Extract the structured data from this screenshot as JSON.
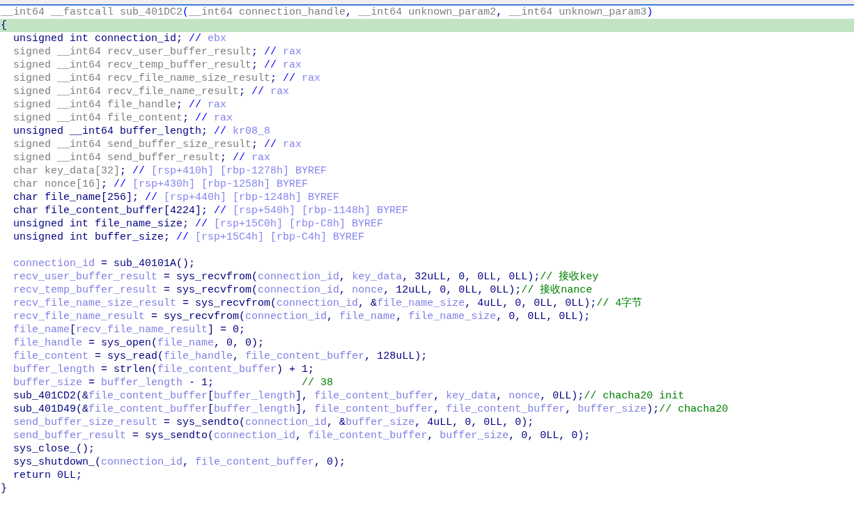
{
  "lines": [
    {
      "kind": "edge",
      "selected": false,
      "tokens": [
        {
          "kind": "g",
          "text": "__int64 __fastcall sub_401DC2"
        },
        {
          "kind": "b",
          "text": "("
        },
        {
          "kind": "g",
          "text": "__int64 connection_handle"
        },
        {
          "kind": "p",
          "text": ", "
        },
        {
          "kind": "g",
          "text": "__int64 unknown_param2"
        },
        {
          "kind": "p",
          "text": ", "
        },
        {
          "kind": "g",
          "text": "__int64 unknown_param3"
        },
        {
          "kind": "b",
          "text": ")"
        }
      ]
    },
    {
      "kind": "edge",
      "selected": true,
      "tokens": [
        {
          "kind": "p",
          "text": "{"
        }
      ]
    },
    {
      "kind": "stmt",
      "selected": false,
      "tokens": [
        {
          "kind": "p",
          "text": "unsigned int connection_id; "
        },
        {
          "kind": "b",
          "text": "// "
        },
        {
          "kind": "r",
          "text": "ebx"
        }
      ]
    },
    {
      "kind": "stmt",
      "selected": false,
      "tokens": [
        {
          "kind": "g",
          "text": "signed __int64 recv_user_buffer_result"
        },
        {
          "kind": "p",
          "text": "; "
        },
        {
          "kind": "b",
          "text": "// "
        },
        {
          "kind": "r",
          "text": "rax"
        }
      ]
    },
    {
      "kind": "stmt",
      "selected": false,
      "tokens": [
        {
          "kind": "g",
          "text": "signed __int64 recv_temp_buffer_result"
        },
        {
          "kind": "p",
          "text": "; "
        },
        {
          "kind": "b",
          "text": "// "
        },
        {
          "kind": "r",
          "text": "rax"
        }
      ]
    },
    {
      "kind": "stmt",
      "selected": false,
      "tokens": [
        {
          "kind": "g",
          "text": "signed __int64 recv_file_name_size_result"
        },
        {
          "kind": "p",
          "text": "; "
        },
        {
          "kind": "b",
          "text": "// "
        },
        {
          "kind": "r",
          "text": "rax"
        }
      ]
    },
    {
      "kind": "stmt",
      "selected": false,
      "tokens": [
        {
          "kind": "g",
          "text": "signed __int64 recv_file_name_result"
        },
        {
          "kind": "p",
          "text": "; "
        },
        {
          "kind": "b",
          "text": "// "
        },
        {
          "kind": "r",
          "text": "rax"
        }
      ]
    },
    {
      "kind": "stmt",
      "selected": false,
      "tokens": [
        {
          "kind": "g",
          "text": "signed __int64 file_handle"
        },
        {
          "kind": "p",
          "text": "; "
        },
        {
          "kind": "b",
          "text": "// "
        },
        {
          "kind": "r",
          "text": "rax"
        }
      ]
    },
    {
      "kind": "stmt",
      "selected": false,
      "tokens": [
        {
          "kind": "g",
          "text": "signed __int64 file_content"
        },
        {
          "kind": "p",
          "text": "; "
        },
        {
          "kind": "b",
          "text": "// "
        },
        {
          "kind": "r",
          "text": "rax"
        }
      ]
    },
    {
      "kind": "stmt",
      "selected": false,
      "tokens": [
        {
          "kind": "p",
          "text": "unsigned __int64 buffer_length; "
        },
        {
          "kind": "b",
          "text": "// "
        },
        {
          "kind": "r",
          "text": "kr08_8"
        }
      ]
    },
    {
      "kind": "stmt",
      "selected": false,
      "tokens": [
        {
          "kind": "g",
          "text": "signed __int64 send_buffer_size_result"
        },
        {
          "kind": "p",
          "text": "; "
        },
        {
          "kind": "b",
          "text": "// "
        },
        {
          "kind": "r",
          "text": "rax"
        }
      ]
    },
    {
      "kind": "stmt",
      "selected": false,
      "tokens": [
        {
          "kind": "g",
          "text": "signed __int64 send_buffer_result"
        },
        {
          "kind": "p",
          "text": "; "
        },
        {
          "kind": "b",
          "text": "// "
        },
        {
          "kind": "r",
          "text": "rax"
        }
      ]
    },
    {
      "kind": "stmt",
      "selected": false,
      "tokens": [
        {
          "kind": "g",
          "text": "char key_data[32]"
        },
        {
          "kind": "p",
          "text": "; "
        },
        {
          "kind": "b",
          "text": "// "
        },
        {
          "kind": "r",
          "text": "[rsp+410h] [rbp-1278h] BYREF"
        }
      ]
    },
    {
      "kind": "stmt",
      "selected": false,
      "tokens": [
        {
          "kind": "g",
          "text": "char nonce[16]"
        },
        {
          "kind": "p",
          "text": "; "
        },
        {
          "kind": "b",
          "text": "// "
        },
        {
          "kind": "r",
          "text": "[rsp+430h] [rbp-1258h] BYREF"
        }
      ]
    },
    {
      "kind": "stmt",
      "selected": false,
      "tokens": [
        {
          "kind": "p",
          "text": "char file_name[256]; "
        },
        {
          "kind": "b",
          "text": "// "
        },
        {
          "kind": "r",
          "text": "[rsp+440h] [rbp-1248h] BYREF"
        }
      ]
    },
    {
      "kind": "stmt",
      "selected": false,
      "tokens": [
        {
          "kind": "p",
          "text": "char file_content_buffer[4224]; "
        },
        {
          "kind": "b",
          "text": "// "
        },
        {
          "kind": "r",
          "text": "[rsp+540h] [rbp-1148h] BYREF"
        }
      ]
    },
    {
      "kind": "stmt",
      "selected": false,
      "tokens": [
        {
          "kind": "p",
          "text": "unsigned int file_name_size; "
        },
        {
          "kind": "b",
          "text": "// "
        },
        {
          "kind": "r",
          "text": "[rsp+15C0h] [rbp-C8h] BYREF"
        }
      ]
    },
    {
      "kind": "stmt",
      "selected": false,
      "tokens": [
        {
          "kind": "p",
          "text": "unsigned int buffer_size; "
        },
        {
          "kind": "b",
          "text": "// "
        },
        {
          "kind": "r",
          "text": "[rsp+15C4h] [rbp-C4h] BYREF"
        }
      ]
    },
    {
      "kind": "blank",
      "selected": false
    },
    {
      "kind": "stmt",
      "selected": false,
      "tokens": [
        {
          "kind": "v",
          "text": "connection_id"
        },
        {
          "kind": "p",
          "text": " = sub_40101A();"
        }
      ]
    },
    {
      "kind": "stmt",
      "selected": false,
      "tokens": [
        {
          "kind": "v",
          "text": "recv_user_buffer_result"
        },
        {
          "kind": "p",
          "text": " = sys_recvfrom("
        },
        {
          "kind": "v",
          "text": "connection_id"
        },
        {
          "kind": "p",
          "text": ", "
        },
        {
          "kind": "v",
          "text": "key_data"
        },
        {
          "kind": "p",
          "text": ", 32uLL, 0, 0LL, 0LL);"
        },
        {
          "kind": "c",
          "text": "// 接收key"
        }
      ]
    },
    {
      "kind": "stmt",
      "selected": false,
      "tokens": [
        {
          "kind": "v",
          "text": "recv_temp_buffer_result"
        },
        {
          "kind": "p",
          "text": " = sys_recvfrom("
        },
        {
          "kind": "v",
          "text": "connection_id"
        },
        {
          "kind": "p",
          "text": ", "
        },
        {
          "kind": "v",
          "text": "nonce"
        },
        {
          "kind": "p",
          "text": ", 12uLL, 0, 0LL, 0LL);"
        },
        {
          "kind": "c",
          "text": "// 接收nance"
        }
      ]
    },
    {
      "kind": "stmt",
      "selected": false,
      "tokens": [
        {
          "kind": "v",
          "text": "recv_file_name_size_result"
        },
        {
          "kind": "p",
          "text": " = sys_recvfrom("
        },
        {
          "kind": "v",
          "text": "connection_id"
        },
        {
          "kind": "p",
          "text": ", &"
        },
        {
          "kind": "v",
          "text": "file_name_size"
        },
        {
          "kind": "p",
          "text": ", 4uLL, 0, 0LL, 0LL);"
        },
        {
          "kind": "c",
          "text": "// 4字节"
        }
      ]
    },
    {
      "kind": "stmt",
      "selected": false,
      "tokens": [
        {
          "kind": "v",
          "text": "recv_file_name_result"
        },
        {
          "kind": "p",
          "text": " = sys_recvfrom("
        },
        {
          "kind": "v",
          "text": "connection_id"
        },
        {
          "kind": "p",
          "text": ", "
        },
        {
          "kind": "v",
          "text": "file_name"
        },
        {
          "kind": "p",
          "text": ", "
        },
        {
          "kind": "v",
          "text": "file_name_size"
        },
        {
          "kind": "p",
          "text": ", 0, 0LL, 0LL);"
        }
      ]
    },
    {
      "kind": "stmt",
      "selected": false,
      "tokens": [
        {
          "kind": "v",
          "text": "file_name"
        },
        {
          "kind": "p",
          "text": "["
        },
        {
          "kind": "v",
          "text": "recv_file_name_result"
        },
        {
          "kind": "p",
          "text": "] = 0;"
        }
      ]
    },
    {
      "kind": "stmt",
      "selected": false,
      "tokens": [
        {
          "kind": "v",
          "text": "file_handle"
        },
        {
          "kind": "p",
          "text": " = sys_open("
        },
        {
          "kind": "v",
          "text": "file_name"
        },
        {
          "kind": "p",
          "text": ", 0, 0);"
        }
      ]
    },
    {
      "kind": "stmt",
      "selected": false,
      "tokens": [
        {
          "kind": "v",
          "text": "file_content"
        },
        {
          "kind": "p",
          "text": " = sys_read("
        },
        {
          "kind": "v",
          "text": "file_handle"
        },
        {
          "kind": "p",
          "text": ", "
        },
        {
          "kind": "v",
          "text": "file_content_buffer"
        },
        {
          "kind": "p",
          "text": ", 128uLL);"
        }
      ]
    },
    {
      "kind": "stmt",
      "selected": false,
      "tokens": [
        {
          "kind": "v",
          "text": "buffer_length"
        },
        {
          "kind": "p",
          "text": " = strlen("
        },
        {
          "kind": "v",
          "text": "file_content_buffer"
        },
        {
          "kind": "p",
          "text": ") + 1;"
        }
      ]
    },
    {
      "kind": "stmt",
      "selected": false,
      "tokens": [
        {
          "kind": "v",
          "text": "buffer_size"
        },
        {
          "kind": "p",
          "text": " = "
        },
        {
          "kind": "v",
          "text": "buffer_length"
        },
        {
          "kind": "p",
          "text": " - 1;"
        },
        {
          "kind": "ca",
          "text": "// 38"
        }
      ]
    },
    {
      "kind": "stmt",
      "selected": false,
      "tokens": [
        {
          "kind": "p",
          "text": "sub_401CD2(&"
        },
        {
          "kind": "v",
          "text": "file_content_buffer"
        },
        {
          "kind": "p",
          "text": "["
        },
        {
          "kind": "v",
          "text": "buffer_length"
        },
        {
          "kind": "p",
          "text": "], "
        },
        {
          "kind": "v",
          "text": "file_content_buffer"
        },
        {
          "kind": "p",
          "text": ", "
        },
        {
          "kind": "v",
          "text": "key_data"
        },
        {
          "kind": "p",
          "text": ", "
        },
        {
          "kind": "v",
          "text": "nonce"
        },
        {
          "kind": "p",
          "text": ", 0LL);"
        },
        {
          "kind": "c",
          "text": "// chacha20 init"
        }
      ]
    },
    {
      "kind": "stmt",
      "selected": false,
      "tokens": [
        {
          "kind": "p",
          "text": "sub_401D49(&"
        },
        {
          "kind": "v",
          "text": "file_content_buffer"
        },
        {
          "kind": "p",
          "text": "["
        },
        {
          "kind": "v",
          "text": "buffer_length"
        },
        {
          "kind": "p",
          "text": "], "
        },
        {
          "kind": "v",
          "text": "file_content_buffer"
        },
        {
          "kind": "p",
          "text": ", "
        },
        {
          "kind": "v",
          "text": "file_content_buffer"
        },
        {
          "kind": "p",
          "text": ", "
        },
        {
          "kind": "v",
          "text": "buffer_size"
        },
        {
          "kind": "p",
          "text": ");"
        },
        {
          "kind": "c",
          "text": "// chacha20"
        }
      ]
    },
    {
      "kind": "stmt",
      "selected": false,
      "tokens": [
        {
          "kind": "v",
          "text": "send_buffer_size_result"
        },
        {
          "kind": "p",
          "text": " = sys_sendto("
        },
        {
          "kind": "v",
          "text": "connection_id"
        },
        {
          "kind": "p",
          "text": ", &"
        },
        {
          "kind": "v",
          "text": "buffer_size"
        },
        {
          "kind": "p",
          "text": ", 4uLL, 0, 0LL, 0);"
        }
      ]
    },
    {
      "kind": "stmt",
      "selected": false,
      "tokens": [
        {
          "kind": "v",
          "text": "send_buffer_result"
        },
        {
          "kind": "p",
          "text": " = sys_sendto("
        },
        {
          "kind": "v",
          "text": "connection_id"
        },
        {
          "kind": "p",
          "text": ", "
        },
        {
          "kind": "v",
          "text": "file_content_buffer"
        },
        {
          "kind": "p",
          "text": ", "
        },
        {
          "kind": "v",
          "text": "buffer_size"
        },
        {
          "kind": "p",
          "text": ", 0, 0LL, 0);"
        }
      ]
    },
    {
      "kind": "stmt",
      "selected": false,
      "tokens": [
        {
          "kind": "p",
          "text": "sys_close_();"
        }
      ]
    },
    {
      "kind": "stmt",
      "selected": false,
      "tokens": [
        {
          "kind": "p",
          "text": "sys_shutdown_("
        },
        {
          "kind": "v",
          "text": "connection_id"
        },
        {
          "kind": "p",
          "text": ", "
        },
        {
          "kind": "v",
          "text": "file_content_buffer"
        },
        {
          "kind": "p",
          "text": ", 0);"
        }
      ]
    },
    {
      "kind": "stmt",
      "selected": false,
      "tokens": [
        {
          "kind": "p",
          "text": "return 0LL;"
        }
      ]
    },
    {
      "kind": "edge",
      "selected": false,
      "tokens": [
        {
          "kind": "p",
          "text": "}"
        }
      ]
    }
  ]
}
